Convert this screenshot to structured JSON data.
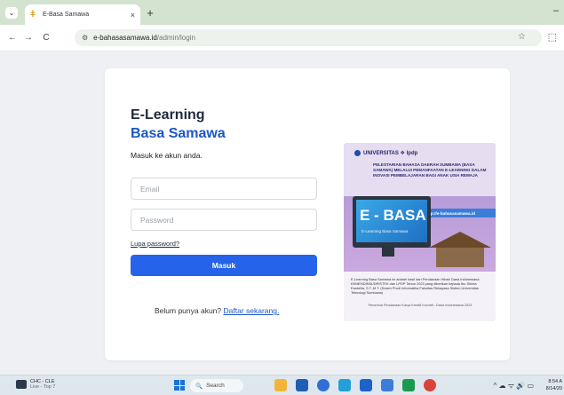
{
  "browser": {
    "tab_title": "E-Basa Samawa",
    "tab_close_icon": "×",
    "new_tab_icon": "+",
    "window_minimize_icon": "–",
    "nav_back_icon": "←",
    "nav_forward_icon": "→",
    "reload_icon": "C",
    "site_info_icon": "⚙",
    "url_host": "e-bahasasamawa.id",
    "url_path": "/admin/login",
    "bookmark_icon": "☆",
    "extensions_icon": "⬚",
    "tab_menu_icon": "⌄",
    "tab_favicon": "ǂ"
  },
  "login": {
    "brand_line1": "E-Learning",
    "brand_line2": "Basa Samawa",
    "subtitle": "Masuk ke akun anda.",
    "email_placeholder": "Email",
    "password_placeholder": "Password",
    "forgot_label": "Lupa password?",
    "submit_label": "Masuk",
    "register_prompt": "Belum punya akun?",
    "register_link": "Daftar sekarang."
  },
  "poster": {
    "logos_text": "UNIVERSITAS ❖ lpdp",
    "heading": "PELESTARIAN BAHASA DAERAH SUMBAWA (BASA SAMAWA) MELALUI PEMANFAATAN E-LEARNING DALAM INOVASI PEMBELAJARAN BAGI ANAK USIA REMAJA",
    "url": "http://e-bahasasamawa.id",
    "app_name": "E - BASA",
    "app_sub": "E-Learning Basa Samawa",
    "description": "E-Learning Basa Samawa ini adalah hasil dari Pendanaan Hibah Dana Indonesiana KEMENDIKBUDRISTEK dan LPDP Tahun 2023 yang diberikan kepada Ibu Shinta Esabella, S.T.,M.T. (Dosen Prodi Informatika Fakultas Rekayasa Sistem Universitas Teknologi Sumbawa)",
    "footer": "Penerima Pendanaan Karya Kreatif Inovatif - Dana Indonesiana 2023"
  },
  "taskbar": {
    "weather_title": "CHC - CLE",
    "weather_sub": "Live - Top 7",
    "search_label": "Search",
    "search_icon": "🔍",
    "tray_icons": "^ ☁ ᯤ 🔊 ▭",
    "time": "8:54 A",
    "date": "8/14/20"
  }
}
